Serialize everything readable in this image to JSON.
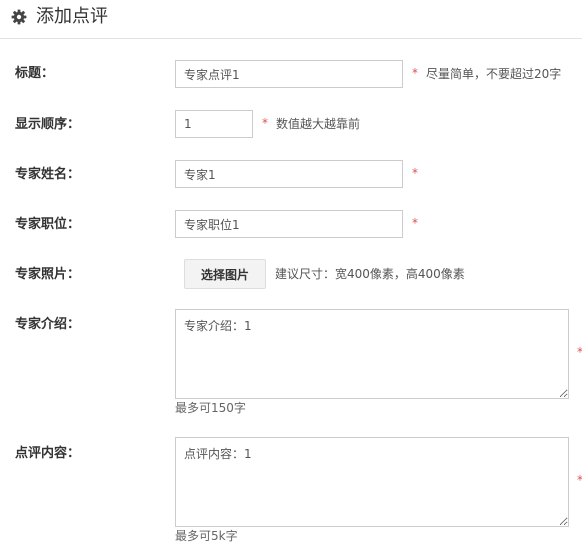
{
  "header": {
    "title": "添加点评",
    "icon": "gear-icon"
  },
  "form": {
    "title_field": {
      "label": "标题：",
      "value": "专家点评1",
      "required": "*",
      "hint": "尽量简单，不要超过20字"
    },
    "order_field": {
      "label": "显示顺序：",
      "value": "1",
      "required": "*",
      "hint": "数值越大越靠前"
    },
    "name_field": {
      "label": "专家姓名：",
      "value": "专家1",
      "required": "*"
    },
    "position_field": {
      "label": "专家职位：",
      "value": "专家职位1",
      "required": "*"
    },
    "photo_field": {
      "label": "专家照片：",
      "button_label": "选择图片",
      "hint": "建议尺寸：宽400像素，高400像素"
    },
    "intro_field": {
      "label": "专家介绍：",
      "value": "专家介绍：1",
      "required": "*",
      "limit": "最多可150字"
    },
    "content_field": {
      "label": "点评内容：",
      "value": "点评内容：1",
      "required": "*",
      "limit": "最多可5k字"
    }
  },
  "colors": {
    "required_star": "#d9534f",
    "border": "#cccccc",
    "button_bg": "#f3f3f3"
  }
}
